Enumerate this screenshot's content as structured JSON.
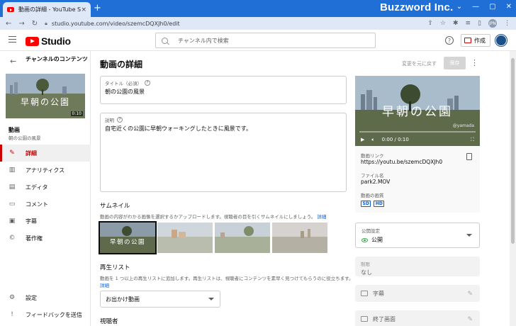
{
  "browser": {
    "tab_title": "動画の詳細 - YouTube Studio",
    "tab_close": "×",
    "new_tab": "+",
    "brand": "Buzzword Inc.",
    "url": "studio.youtube.com/video/szemcDQXJh0/edit",
    "profile_initials": "JPN"
  },
  "header": {
    "logo_text": "Studio",
    "search_placeholder": "チャンネル内で検索",
    "help": "?",
    "create_label": "作成"
  },
  "sidebar": {
    "channel_title": "チャンネルのコンテンツ",
    "thumb_duration": "0:10",
    "thumb_text": "早朝の公園",
    "video_label": "動画",
    "video_name": "朝の公園の風景",
    "items": [
      {
        "label": "詳細",
        "icon": "pencil-icon",
        "glyph": "✎"
      },
      {
        "label": "アナリティクス",
        "icon": "analytics-icon",
        "glyph": "▥"
      },
      {
        "label": "エディタ",
        "icon": "editor-icon",
        "glyph": "▤"
      },
      {
        "label": "コメント",
        "icon": "comment-icon",
        "glyph": "▭"
      },
      {
        "label": "字幕",
        "icon": "subtitles-icon",
        "glyph": "▣"
      },
      {
        "label": "著作権",
        "icon": "copyright-icon",
        "glyph": "©"
      }
    ],
    "bottom_items": [
      {
        "label": "設定",
        "icon": "gear-icon",
        "glyph": "⚙"
      },
      {
        "label": "フィードバックを送信",
        "icon": "feedback-icon",
        "glyph": "!"
      }
    ]
  },
  "main": {
    "page_title": "動画の詳細",
    "undo_label": "変更を元に戻す",
    "save_label": "保存",
    "title_field": {
      "label": "タイトル（必須）",
      "value": "朝の公園の風景"
    },
    "desc_field": {
      "label": "説明",
      "value": "自宅近くの公園に早朝ウォーキングしたときに風景です。"
    },
    "thumbnail": {
      "title": "サムネイル",
      "desc": "動画の内容がわかる画像を選択するかアップロードします。視聴者の目を引くサムネイルにしましょう。",
      "link": "詳細",
      "selected_text": "早朝の公園"
    },
    "playlist": {
      "title": "再生リスト",
      "desc": "動画を 1 つ以上の再生リストに追加します。再生リストは、視聴者にコンテンツを素早く見つけてもらうのに役立ちます。",
      "link": "詳細",
      "selected": "お出かけ動画"
    },
    "audience_title": "視聴者"
  },
  "right": {
    "preview_text": "早朝の公園",
    "watermark": "@yamada",
    "time": "0:00 / 0:10",
    "video_link_label": "動画リンク",
    "video_link": "https://youtu.be/szemcDQXJh0",
    "filename_label": "ファイル名",
    "filename": "park2.MOV",
    "quality_label": "動画の画質",
    "quality_badges": [
      "SD",
      "HD"
    ],
    "visibility_label": "公開設定",
    "visibility_value": "公開",
    "restriction_label": "制限",
    "restriction_value": "なし",
    "subtitles_label": "字幕",
    "endscreen_label": "終了画面"
  },
  "colors": {
    "accent_red": "#cc0000",
    "link_blue": "#065fd4",
    "chrome_blue": "#1f6fd6"
  }
}
